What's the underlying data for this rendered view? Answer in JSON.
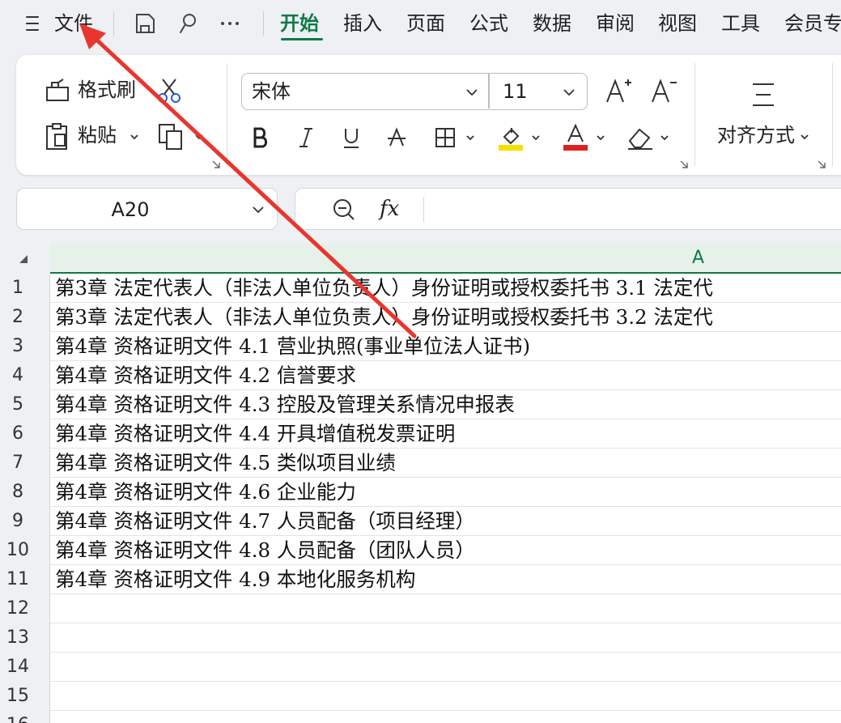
{
  "menu": {
    "file_label": "文件",
    "tabs": [
      "开始",
      "插入",
      "页面",
      "公式",
      "数据",
      "审阅",
      "视图",
      "工具",
      "会员专"
    ]
  },
  "ribbon": {
    "format_painter": "格式刷",
    "paste": "粘贴",
    "font_name": "宋体",
    "font_size": "11",
    "align_label": "对齐方式"
  },
  "name_box": {
    "value": "A20"
  },
  "formula_bar": {
    "fx_label": "fx"
  },
  "sheet": {
    "column_label": "A",
    "row_numbers": [
      "1",
      "2",
      "3",
      "4",
      "5",
      "6",
      "7",
      "8",
      "9",
      "10",
      "11",
      "12",
      "13",
      "14",
      "15",
      "16"
    ],
    "cells": [
      "第3章 法定代表人（非法人单位负责人）身份证明或授权委托书 3.1 法定代",
      "第3章 法定代表人（非法人单位负责人）身份证明或授权委托书 3.2 法定代",
      "第4章 资格证明文件 4.1 营业执照(事业单位法人证书)",
      "第4章 资格证明文件 4.2 信誉要求",
      "第4章 资格证明文件 4.3 控股及管理关系情况申报表",
      "第4章 资格证明文件 4.4 开具增值税发票证明",
      "第4章 资格证明文件 4.5 类似项目业绩",
      "第4章 资格证明文件 4.6 企业能力",
      "第4章 资格证明文件 4.7 人员配备（项目经理）",
      "第4章 资格证明文件 4.8 人员配备（团队人员）",
      "第4章 资格证明文件 4.9 本地化服务机构"
    ]
  },
  "colors": {
    "accent": "#0e7a45",
    "highlight": "#f5e000",
    "font_color": "#e02020",
    "annotation": "#e8362e"
  }
}
